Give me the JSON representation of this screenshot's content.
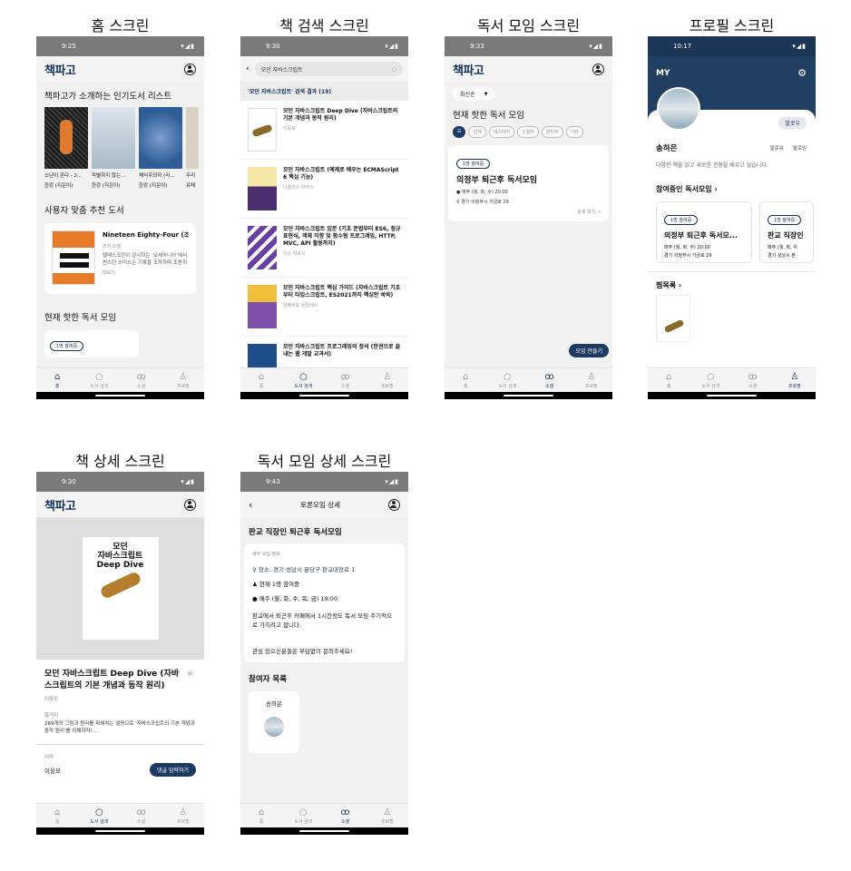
{
  "app": {
    "logo": "책파고"
  },
  "nav": {
    "home": "홈",
    "search": "도서 검색",
    "club": "소셜",
    "profile": "프로필"
  },
  "screens": {
    "home": {
      "title": "홈 스크린",
      "time": "9:25",
      "popular_title": "책파고가 소개하는 인기도서 리스트",
      "books": [
        {
          "title": "소년이 온다 - 2...",
          "author": "한강 (지은이)",
          "color": "#1c1c1c"
        },
        {
          "title": "작별하지 않는...",
          "author": "한강 (지은이)",
          "color": "#c7d4df"
        },
        {
          "title": "채식주의자 (리...",
          "author": "한강 (지은이)",
          "color": "#4c78a8"
        },
        {
          "title": "우리",
          "author": "유채",
          "color": "#e7e7e7"
        }
      ],
      "rec_title": "사용자 맞춤 추천 도서",
      "rec_book": {
        "title": "Nineteen Eighty-Four (조...",
        "author": "조지 오웰",
        "desc": "텔레스크린이 감시하는 ‘오세아니아’에서 윈스턴 스미스는 기록을 조작하며 조용히 반역을 꿈꾼다.",
        "more": "더보기"
      },
      "club_title": "현재 핫한 독서 모임",
      "club_badge": "1명 참여중"
    },
    "search": {
      "title": "책 검색 스크린",
      "time": "9:30",
      "query": "모던 자바스크립트",
      "result_head": "'모던 자바스크립트' 검색 결과 (19)",
      "results": [
        {
          "title": "모던 자바스크립트 Deep Dive (자바스크립트의 기본 개념과 동작 원리)",
          "author": "이웅모",
          "color": "#ffffff"
        },
        {
          "title": "모던 자바스크립트 (예제로 배우는 ECMAScript 6 핵심 기능)",
          "author": "니콜라스 자카스",
          "color": "#f2e3a0"
        },
        {
          "title": "모던 자바스크립트 입문 (기초 문법부터 ES6, 정규 표현식, 객체 지향 및 함수형 프로그래밍, HTTP, MVC, API 활용까지)",
          "author": "이소 히로시",
          "color": "#6a3fa1"
        },
        {
          "title": "모던 자바스크립트 핵심 가이드 (자바스크립트 기초부터 타입스크립트, ES2021까지 핵심만 쏙쏙)",
          "author": "알베르토 몬탈레시",
          "color": "#7d4fa8"
        },
        {
          "title": "모던 자바스크립트 프로그래밍의 정석 (한권으로 끝내는 웹 개발 교과서)",
          "author": "",
          "color": "#1f4e8c"
        }
      ]
    },
    "club": {
      "title": "독서 모임 스크린",
      "time": "9:33",
      "sort": "최신순",
      "section": "현재 핫한 독서 모임",
      "chips": [
        "전체",
        "미스터리",
        "스릴러",
        "판타지",
        "기타"
      ],
      "card": {
        "badge": "1명 참여중",
        "name": "의정부 퇴근후 독서모임",
        "schedule": "매주 (월, 화, 수) 20:00",
        "place": "경기 의정부시 가금로 29",
        "more": "상세 보기 →"
      },
      "fab": "모임 만들기"
    },
    "profile": {
      "title": "프로필 스크린",
      "time": "10:17",
      "header": "MY",
      "follow_btn": "팔로우",
      "name": "송하은",
      "follower": "팔로워",
      "following": "팔로잉",
      "bio": "다양한 책을 읽고 새로운 관점을 배우고 싶습니다.",
      "joined_title": "참여중인 독서모임",
      "clubs": [
        {
          "badge": "1명 참여중",
          "name": "의정부 퇴근후 독서모...",
          "schedule": "매주 (월, 화, 수) 20:00",
          "place": "경기 의정부시 가금로 29"
        },
        {
          "badge": "1명 참여중",
          "name": "판교 직장인",
          "schedule": "매주 (월, 화, 수",
          "place": "경기 성남시 분"
        }
      ],
      "wish_title": "찜목록"
    },
    "detail": {
      "title": "책 상세 스크린",
      "time": "9:30",
      "cover_title": "모던\n자바스크립트\nDeep Dive",
      "book_title": "모던 자바스크립트 Deep Dive (자바스크립트의 기본 개념과 동작 원리)",
      "author": "이웅모",
      "summary_label": "줄거리",
      "summary": "269개의 그림과 원리를 파헤치는 설명으로 '자바스크립트의 기본 개념과 동작 원리'를 이해하자!...",
      "writer_label": "저자",
      "writer": "이웅모",
      "comment_btn": "댓글 입력하기"
    },
    "club_detail": {
      "title": "독서 모임 상세 스크린",
      "time": "9:43",
      "header": "토론모임 상세",
      "club_name": "판교 직장인 퇴근후 독서모임",
      "info_label": "세부 모집 정보",
      "place": "장소: 경기 성남시 분당구 판교대장로 1",
      "count": "현재 1명 참여중",
      "schedule": "매주 (월, 화, 수, 목, 금) 19:00",
      "desc": "판교에서 퇴근후 카페에서 1시간정도 독서 모임 주기적으로 가지려고 합니다.",
      "desc2": "관심 있으신분들은 부담없이 문의주세요!",
      "members_title": "참여자 목록",
      "member": "송하은"
    }
  }
}
